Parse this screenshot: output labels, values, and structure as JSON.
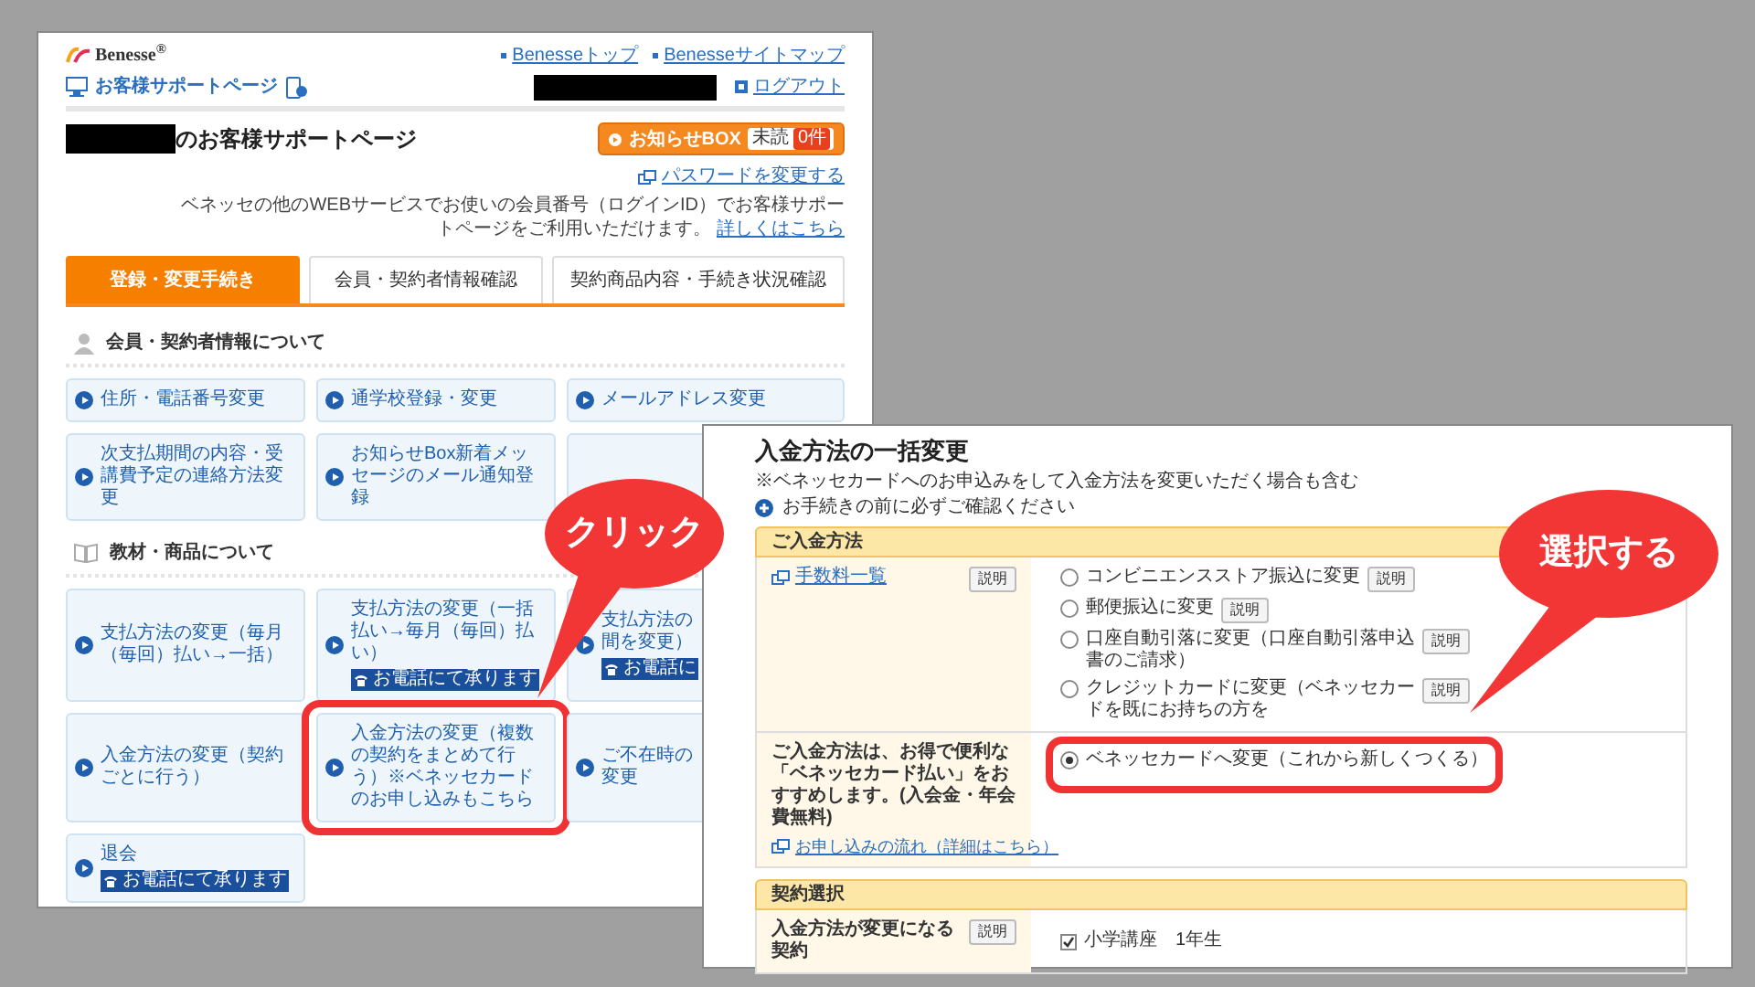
{
  "support_page": {
    "logo": "Benesse$^{®}$",
    "header_links": [
      "Benesseトップ",
      "Benesseサイトマップ"
    ],
    "site_title": "お客様サポートページ",
    "logout": "ログアウト",
    "page_title": "のお客様サポートページ",
    "notice_box": {
      "label": "お知らせBOX",
      "unread": "未読",
      "count": "0件"
    },
    "password_link": "パスワードを変更する",
    "info": "ベネッセの他のWEBサービスでお使いの会員番号（ログインID）でお客様サポートページをご利用いただけます。",
    "info_link": "詳しくはこちら",
    "tabs": [
      {
        "label": "登録・変更手続き",
        "selected": true
      },
      {
        "label": "会員・契約者情報確認",
        "selected": false
      },
      {
        "label": "契約商品内容・手続き状況確認",
        "selected": false
      }
    ],
    "sections": [
      {
        "title": "会員・契約者情報について",
        "kind": "person",
        "cards": [
          {
            "text": "住所・電話番号変更",
            "highlighted": false
          },
          {
            "text": "通学校登録・変更",
            "highlighted": false
          },
          {
            "text": "メールアドレス変更",
            "highlighted": false
          },
          {
            "text": "次支払期間の内容・受講費予定の連絡方法変更",
            "highlighted": false
          },
          {
            "text": "お知らせBox新着メッセージのメール通知登録",
            "highlighted": false
          },
          {
            "kind": "covered"
          }
        ]
      },
      {
        "title": "教材・商品について",
        "kind": "book",
        "cards": [
          {
            "text": "支払方法の変更（毎月（毎回）払い→一括）",
            "highlighted": false
          },
          {
            "text": "支払方法の変更（一括払い→毎月（毎回）払い）",
            "badge": "お電話にて承ります",
            "highlighted": false
          },
          {
            "lines": [
              "支払方法の",
              "間を変更）"
            ],
            "badge": "お電話に",
            "highlighted": false
          },
          {
            "text": "入金方法の変更（契約ごとに行う）",
            "highlighted": false
          },
          {
            "text": "入金方法の変更（複数の契約をまとめて行う）※ベネッセカードのお申し込みもこちら",
            "highlighted": true
          },
          {
            "lines": [
              "ご不在時の",
              "変更"
            ],
            "highlighted": false
          },
          {
            "text": "退会",
            "badge": "お電話にて承ります",
            "highlighted": false
          }
        ]
      }
    ]
  },
  "change_form": {
    "title": "入金方法の一括変更",
    "note": "※ベネッセカードへのお申込みをして入金方法を変更いただく場合も含む",
    "confirm": "お手続きの前に必ずご確認ください",
    "sections": [
      {
        "title": "ご入金方法",
        "rows": [
          {
            "label_link": "手数料一覧",
            "help": "説明",
            "options": [
              {
                "label": "コンビニエンスストア振込に変更",
                "help": "説明",
                "selected": false,
                "highlighted": false
              },
              {
                "label": "郵便振込に変更",
                "help": "説明",
                "selected": false,
                "highlighted": false
              },
              {
                "label": "口座自動引落に変更（口座自動引落申込書のご請求）",
                "help": "説明",
                "selected": false,
                "highlighted": false
              },
              {
                "label": "クレジットカードに変更（ベネッセカードを既にお持ちの方を",
                "help": "説明",
                "selected": false,
                "highlighted": false
              }
            ]
          },
          {
            "label": "ご入金方法は、お得で便利な「ベネッセカード払い」をおすすめします。(入会金・年会費無料)",
            "link": "お申し込みの流れ（詳細はこちら）",
            "options": [
              {
                "label": "ベネッセカードへ変更（これから新しくつくる）",
                "selected": true,
                "highlighted": true
              }
            ]
          }
        ]
      },
      {
        "title": "契約選択",
        "rows": [
          {
            "label": "入金方法が変更になる契約",
            "help": "説明",
            "contracts": [
              {
                "label": "小学講座　1年生",
                "checked": true
              }
            ]
          }
        ]
      }
    ]
  },
  "callouts": [
    {
      "text": "クリック"
    },
    {
      "text": "選択する"
    }
  ]
}
